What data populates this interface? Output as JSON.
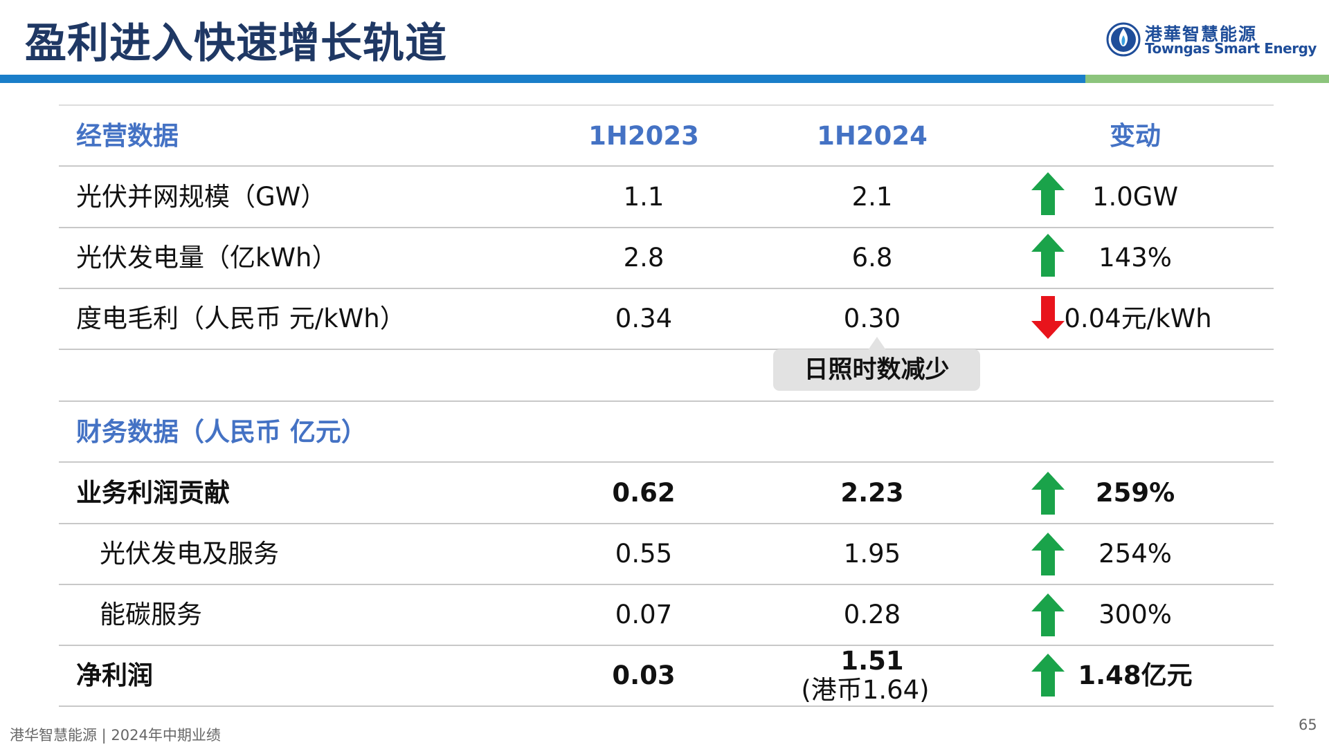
{
  "header": {
    "title": "盈利进入快速增长轨道",
    "logo_cn": "港華智慧能源",
    "logo_en": "Towngas Smart Energy"
  },
  "colors": {
    "title": "#1f3864",
    "header_text": "#4472c4",
    "rule_blue": "#1a7ec9",
    "rule_green": "#8cc47c",
    "arrow_up": "#1aa34a",
    "arrow_down": "#e8141c"
  },
  "table": {
    "operating_header": {
      "label": "经营数据",
      "col1": "1H2023",
      "col2": "1H2024",
      "col3": "变动"
    },
    "operating_rows": [
      {
        "label": "光伏并网规模（GW）",
        "v2023": "1.1",
        "v2024": "2.1",
        "change": "1.0GW",
        "direction": "up"
      },
      {
        "label": "光伏发电量（亿kWh）",
        "v2023": "2.8",
        "v2024": "6.8",
        "change": "143%",
        "direction": "up"
      },
      {
        "label": "度电毛利（人民币 元/kWh）",
        "v2023": "0.34",
        "v2024": "0.30",
        "change": "0.04元/kWh",
        "direction": "down"
      }
    ],
    "callout": "日照时数减少",
    "financial_header": "财务数据（人民币 亿元）",
    "financial_rows": [
      {
        "label": "业务利润贡献",
        "v2023": "0.62",
        "v2024": "2.23",
        "change": "259%",
        "direction": "up",
        "bold": true
      },
      {
        "label": "光伏发电及服务",
        "v2023": "0.55",
        "v2024": "1.95",
        "change": "254%",
        "direction": "up",
        "indent": true
      },
      {
        "label": "能碳服务",
        "v2023": "0.07",
        "v2024": "0.28",
        "change": "300%",
        "direction": "up",
        "indent": true
      },
      {
        "label": "净利润",
        "v2023": "0.03",
        "v2024": "1.51",
        "v2024_sub": "(港币1.64)",
        "change": "1.48亿元",
        "direction": "up",
        "bold": true
      }
    ]
  },
  "footer": {
    "text": "港华智慧能源 | 2024年中期业绩",
    "page": "65"
  }
}
